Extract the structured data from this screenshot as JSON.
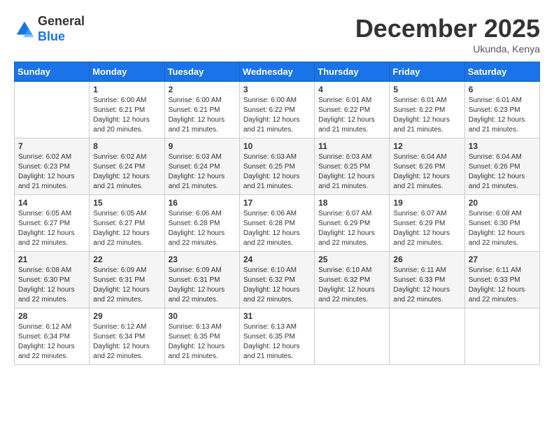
{
  "header": {
    "logo_general": "General",
    "logo_blue": "Blue",
    "month": "December 2025",
    "location": "Ukunda, Kenya"
  },
  "weekdays": [
    "Sunday",
    "Monday",
    "Tuesday",
    "Wednesday",
    "Thursday",
    "Friday",
    "Saturday"
  ],
  "weeks": [
    [
      {
        "day": "",
        "sunrise": "",
        "sunset": "",
        "daylight": ""
      },
      {
        "day": "1",
        "sunrise": "Sunrise: 6:00 AM",
        "sunset": "Sunset: 6:21 PM",
        "daylight": "Daylight: 12 hours and 20 minutes."
      },
      {
        "day": "2",
        "sunrise": "Sunrise: 6:00 AM",
        "sunset": "Sunset: 6:21 PM",
        "daylight": "Daylight: 12 hours and 21 minutes."
      },
      {
        "day": "3",
        "sunrise": "Sunrise: 6:00 AM",
        "sunset": "Sunset: 6:22 PM",
        "daylight": "Daylight: 12 hours and 21 minutes."
      },
      {
        "day": "4",
        "sunrise": "Sunrise: 6:01 AM",
        "sunset": "Sunset: 6:22 PM",
        "daylight": "Daylight: 12 hours and 21 minutes."
      },
      {
        "day": "5",
        "sunrise": "Sunrise: 6:01 AM",
        "sunset": "Sunset: 6:22 PM",
        "daylight": "Daylight: 12 hours and 21 minutes."
      },
      {
        "day": "6",
        "sunrise": "Sunrise: 6:01 AM",
        "sunset": "Sunset: 6:23 PM",
        "daylight": "Daylight: 12 hours and 21 minutes."
      }
    ],
    [
      {
        "day": "7",
        "sunrise": "Sunrise: 6:02 AM",
        "sunset": "Sunset: 6:23 PM",
        "daylight": "Daylight: 12 hours and 21 minutes."
      },
      {
        "day": "8",
        "sunrise": "Sunrise: 6:02 AM",
        "sunset": "Sunset: 6:24 PM",
        "daylight": "Daylight: 12 hours and 21 minutes."
      },
      {
        "day": "9",
        "sunrise": "Sunrise: 6:03 AM",
        "sunset": "Sunset: 6:24 PM",
        "daylight": "Daylight: 12 hours and 21 minutes."
      },
      {
        "day": "10",
        "sunrise": "Sunrise: 6:03 AM",
        "sunset": "Sunset: 6:25 PM",
        "daylight": "Daylight: 12 hours and 21 minutes."
      },
      {
        "day": "11",
        "sunrise": "Sunrise: 6:03 AM",
        "sunset": "Sunset: 6:25 PM",
        "daylight": "Daylight: 12 hours and 21 minutes."
      },
      {
        "day": "12",
        "sunrise": "Sunrise: 6:04 AM",
        "sunset": "Sunset: 6:26 PM",
        "daylight": "Daylight: 12 hours and 21 minutes."
      },
      {
        "day": "13",
        "sunrise": "Sunrise: 6:04 AM",
        "sunset": "Sunset: 6:26 PM",
        "daylight": "Daylight: 12 hours and 21 minutes."
      }
    ],
    [
      {
        "day": "14",
        "sunrise": "Sunrise: 6:05 AM",
        "sunset": "Sunset: 6:27 PM",
        "daylight": "Daylight: 12 hours and 22 minutes."
      },
      {
        "day": "15",
        "sunrise": "Sunrise: 6:05 AM",
        "sunset": "Sunset: 6:27 PM",
        "daylight": "Daylight: 12 hours and 22 minutes."
      },
      {
        "day": "16",
        "sunrise": "Sunrise: 6:06 AM",
        "sunset": "Sunset: 6:28 PM",
        "daylight": "Daylight: 12 hours and 22 minutes."
      },
      {
        "day": "17",
        "sunrise": "Sunrise: 6:06 AM",
        "sunset": "Sunset: 6:28 PM",
        "daylight": "Daylight: 12 hours and 22 minutes."
      },
      {
        "day": "18",
        "sunrise": "Sunrise: 6:07 AM",
        "sunset": "Sunset: 6:29 PM",
        "daylight": "Daylight: 12 hours and 22 minutes."
      },
      {
        "day": "19",
        "sunrise": "Sunrise: 6:07 AM",
        "sunset": "Sunset: 6:29 PM",
        "daylight": "Daylight: 12 hours and 22 minutes."
      },
      {
        "day": "20",
        "sunrise": "Sunrise: 6:08 AM",
        "sunset": "Sunset: 6:30 PM",
        "daylight": "Daylight: 12 hours and 22 minutes."
      }
    ],
    [
      {
        "day": "21",
        "sunrise": "Sunrise: 6:08 AM",
        "sunset": "Sunset: 6:30 PM",
        "daylight": "Daylight: 12 hours and 22 minutes."
      },
      {
        "day": "22",
        "sunrise": "Sunrise: 6:09 AM",
        "sunset": "Sunset: 6:31 PM",
        "daylight": "Daylight: 12 hours and 22 minutes."
      },
      {
        "day": "23",
        "sunrise": "Sunrise: 6:09 AM",
        "sunset": "Sunset: 6:31 PM",
        "daylight": "Daylight: 12 hours and 22 minutes."
      },
      {
        "day": "24",
        "sunrise": "Sunrise: 6:10 AM",
        "sunset": "Sunset: 6:32 PM",
        "daylight": "Daylight: 12 hours and 22 minutes."
      },
      {
        "day": "25",
        "sunrise": "Sunrise: 6:10 AM",
        "sunset": "Sunset: 6:32 PM",
        "daylight": "Daylight: 12 hours and 22 minutes."
      },
      {
        "day": "26",
        "sunrise": "Sunrise: 6:11 AM",
        "sunset": "Sunset: 6:33 PM",
        "daylight": "Daylight: 12 hours and 22 minutes."
      },
      {
        "day": "27",
        "sunrise": "Sunrise: 6:11 AM",
        "sunset": "Sunset: 6:33 PM",
        "daylight": "Daylight: 12 hours and 22 minutes."
      }
    ],
    [
      {
        "day": "28",
        "sunrise": "Sunrise: 6:12 AM",
        "sunset": "Sunset: 6:34 PM",
        "daylight": "Daylight: 12 hours and 22 minutes."
      },
      {
        "day": "29",
        "sunrise": "Sunrise: 6:12 AM",
        "sunset": "Sunset: 6:34 PM",
        "daylight": "Daylight: 12 hours and 22 minutes."
      },
      {
        "day": "30",
        "sunrise": "Sunrise: 6:13 AM",
        "sunset": "Sunset: 6:35 PM",
        "daylight": "Daylight: 12 hours and 21 minutes."
      },
      {
        "day": "31",
        "sunrise": "Sunrise: 6:13 AM",
        "sunset": "Sunset: 6:35 PM",
        "daylight": "Daylight: 12 hours and 21 minutes."
      },
      {
        "day": "",
        "sunrise": "",
        "sunset": "",
        "daylight": ""
      },
      {
        "day": "",
        "sunrise": "",
        "sunset": "",
        "daylight": ""
      },
      {
        "day": "",
        "sunrise": "",
        "sunset": "",
        "daylight": ""
      }
    ]
  ]
}
